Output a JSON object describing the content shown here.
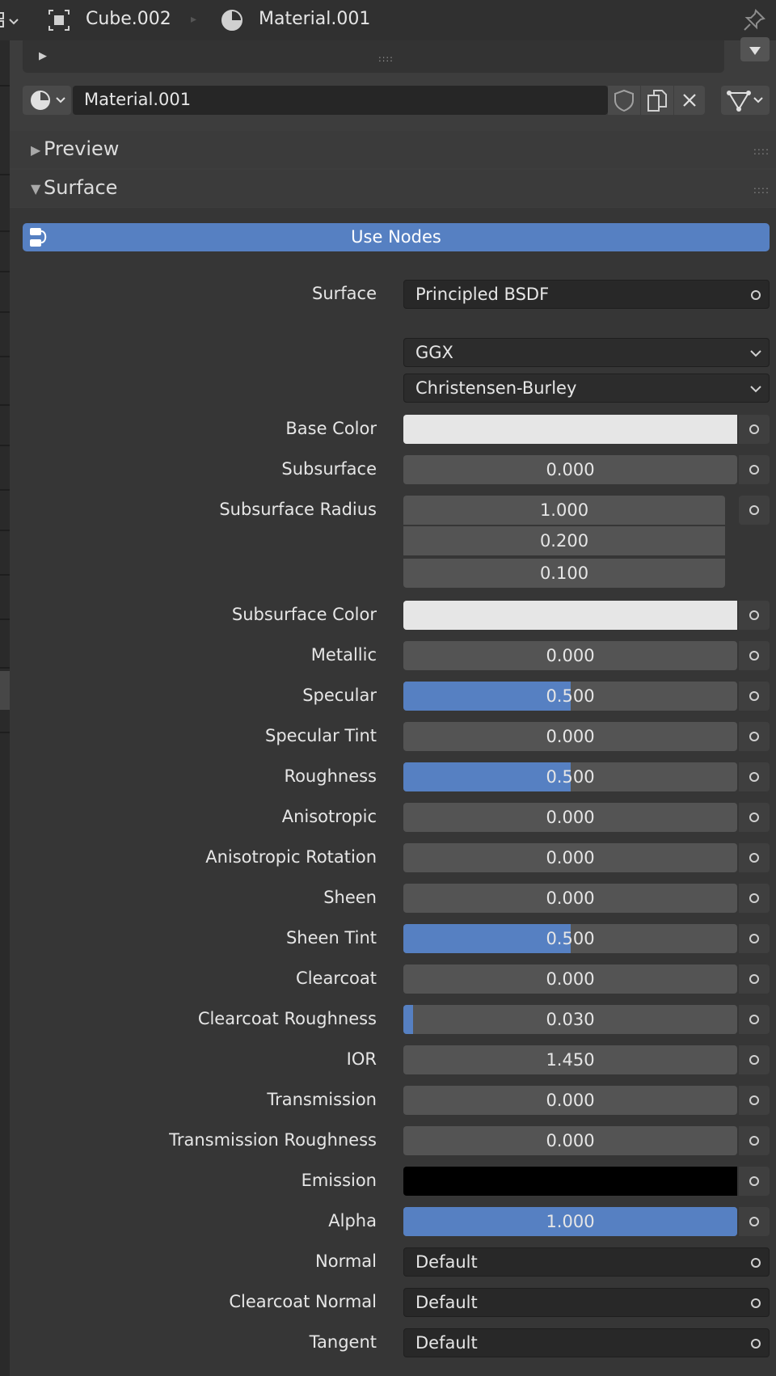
{
  "header": {
    "object_name": "Cube.002",
    "material_name": "Material.001"
  },
  "material_slot": {
    "name": "Material.001"
  },
  "panels": {
    "preview": "Preview",
    "surface": "Surface"
  },
  "use_nodes_label": "Use Nodes",
  "surface": {
    "label": "Surface",
    "shader": "Principled BSDF",
    "distribution": "GGX",
    "subsurface_method": "Christensen-Burley"
  },
  "colors": {
    "accent": "#5680c2",
    "base_color": "#e6e6e6",
    "subsurface_color": "#e6e6e6",
    "emission": "#000000"
  },
  "properties": {
    "base_color": {
      "label": "Base Color"
    },
    "subsurface": {
      "label": "Subsurface",
      "value": "0.000",
      "fill": 0
    },
    "subsurface_radius": {
      "label": "Subsurface Radius",
      "values": [
        "1.000",
        "0.200",
        "0.100"
      ]
    },
    "subsurface_color": {
      "label": "Subsurface Color"
    },
    "metallic": {
      "label": "Metallic",
      "value": "0.000",
      "fill": 0
    },
    "specular": {
      "label": "Specular",
      "value": "0.500",
      "fill": 0.5
    },
    "specular_tint": {
      "label": "Specular Tint",
      "value": "0.000",
      "fill": 0
    },
    "roughness": {
      "label": "Roughness",
      "value": "0.500",
      "fill": 0.5
    },
    "anisotropic": {
      "label": "Anisotropic",
      "value": "0.000",
      "fill": 0
    },
    "anisotropic_rotation": {
      "label": "Anisotropic Rotation",
      "value": "0.000",
      "fill": 0
    },
    "sheen": {
      "label": "Sheen",
      "value": "0.000",
      "fill": 0
    },
    "sheen_tint": {
      "label": "Sheen Tint",
      "value": "0.500",
      "fill": 0.5
    },
    "clearcoat": {
      "label": "Clearcoat",
      "value": "0.000",
      "fill": 0
    },
    "clearcoat_roughness": {
      "label": "Clearcoat Roughness",
      "value": "0.030",
      "fill": 0.03
    },
    "ior": {
      "label": "IOR",
      "value": "1.450",
      "fill": 0
    },
    "transmission": {
      "label": "Transmission",
      "value": "0.000",
      "fill": 0
    },
    "transmission_roughness": {
      "label": "Transmission Roughness",
      "value": "0.000",
      "fill": 0
    },
    "emission": {
      "label": "Emission"
    },
    "alpha": {
      "label": "Alpha",
      "value": "1.000",
      "fill": 1
    },
    "normal": {
      "label": "Normal",
      "value": "Default"
    },
    "clearcoat_normal": {
      "label": "Clearcoat Normal",
      "value": "Default"
    },
    "tangent": {
      "label": "Tangent",
      "value": "Default"
    }
  }
}
